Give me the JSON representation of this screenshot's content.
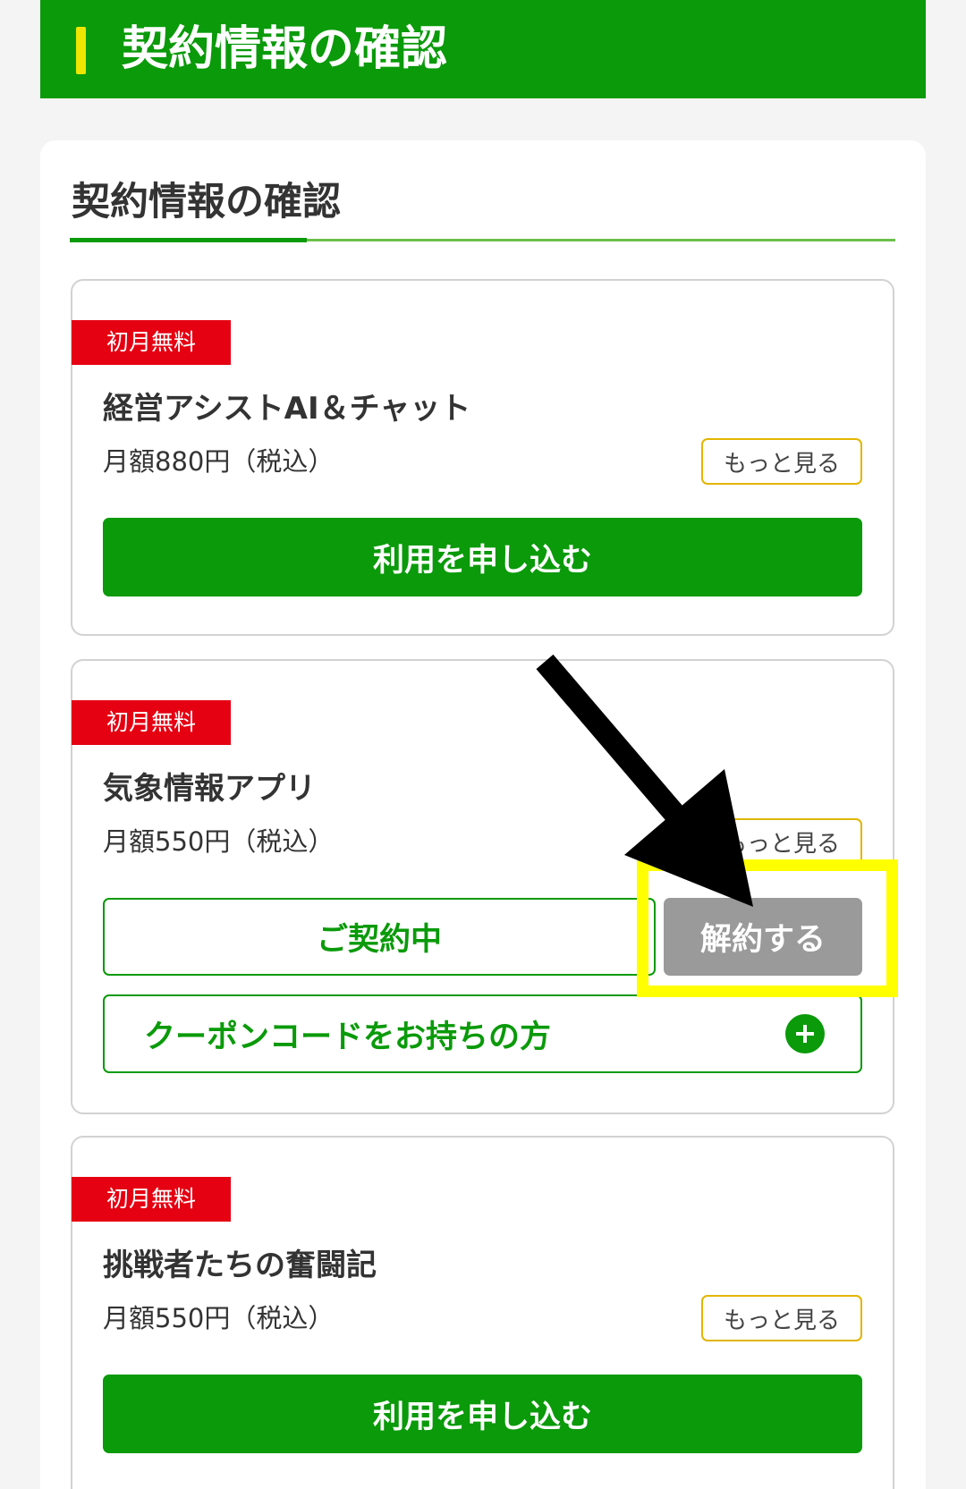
{
  "header": {
    "title": "契約情報の確認"
  },
  "section": {
    "heading": "契約情報の確認"
  },
  "plans": [
    {
      "badge": "初月無料",
      "name": "経営アシストAI＆チャット",
      "price": "月額880円（税込）",
      "more_label": "もっと見る",
      "apply_label": "利用を申し込む"
    },
    {
      "badge": "初月無料",
      "name": "気象情報アプリ",
      "price": "月額550円（税込）",
      "more_label": "もっと見る",
      "status_label": "ご契約中",
      "cancel_label": "解約する",
      "coupon_label": "クーポンコードをお持ちの方"
    },
    {
      "badge": "初月無料",
      "name": "挑戦者たちの奮闘記",
      "price": "月額550円（税込）",
      "more_label": "もっと見る",
      "apply_label": "利用を申し込む"
    }
  ],
  "icons": {
    "coupon_expand": "plus-circle-icon",
    "annotation_pointer": "arrow-icon"
  },
  "colors": {
    "brand_green": "#0a9a0a",
    "accent_yellow": "#eee600",
    "badge_red": "#e50012",
    "more_border": "#e2b500",
    "cancel_gray": "#9a9a9a",
    "highlight_yellow": "#ffff00",
    "page_bg": "#f4f4f4",
    "text_dark": "#333333",
    "annotation_black": "#000000",
    "underline_light": "#6cc04a"
  }
}
